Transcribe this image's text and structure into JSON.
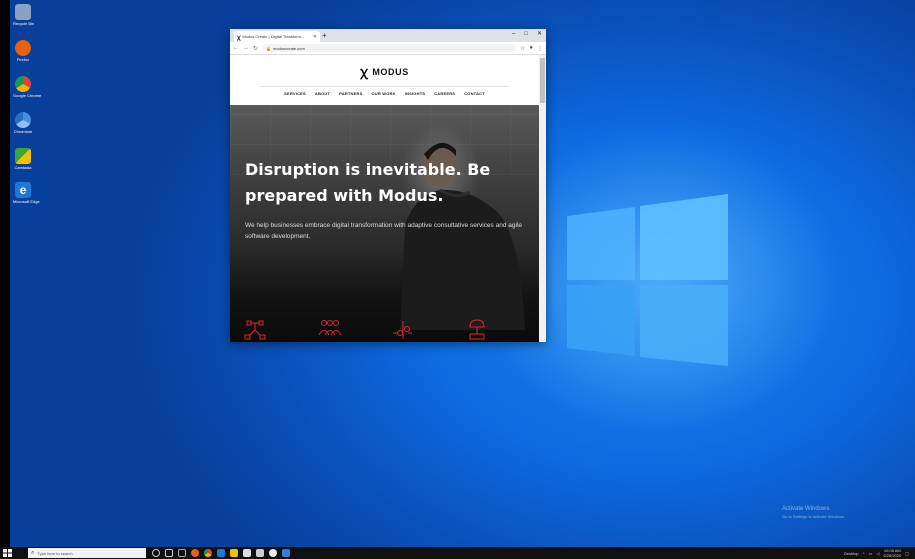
{
  "desktop": {
    "icons": [
      {
        "name": "Recycle Bin",
        "color": "#8aa2c0"
      },
      {
        "name": "Firefox",
        "color": "#e8610f"
      },
      {
        "name": "Google Chrome",
        "color": "#2ea84a"
      },
      {
        "name": "Chromium",
        "color": "#4a8fe0"
      },
      {
        "name": "Camtasia",
        "color": "#3aa53a"
      },
      {
        "name": "Microsoft Edge",
        "color": "#1b7ad8"
      }
    ]
  },
  "browser": {
    "tab_title": "Modus Create | Digital Transform...",
    "new_tab": "+",
    "window_controls": [
      "–",
      "□",
      "✕"
    ],
    "url": "moduscreate.com",
    "site": {
      "logo_text": "MODUS",
      "menu": [
        "SERVICES",
        "ABOUT",
        "PARTNERS",
        "OUR WORK",
        "INSIGHTS",
        "CAREERS",
        "CONTACT"
      ],
      "hero_title": "Disruption is inevitable. Be prepared with Modus.",
      "hero_text": "We help businesses embrace digital transformation with adaptive consultative services and agile software development.",
      "accent_color": "#d9292b"
    }
  },
  "watermark": {
    "title": "Activate Windows",
    "subtitle": "Go to Settings to activate Windows."
  },
  "taskbar": {
    "search_placeholder": "Type here to search",
    "tray_desktop": "Desktop",
    "time": "10:08 AM",
    "date": "5/28/2020"
  }
}
